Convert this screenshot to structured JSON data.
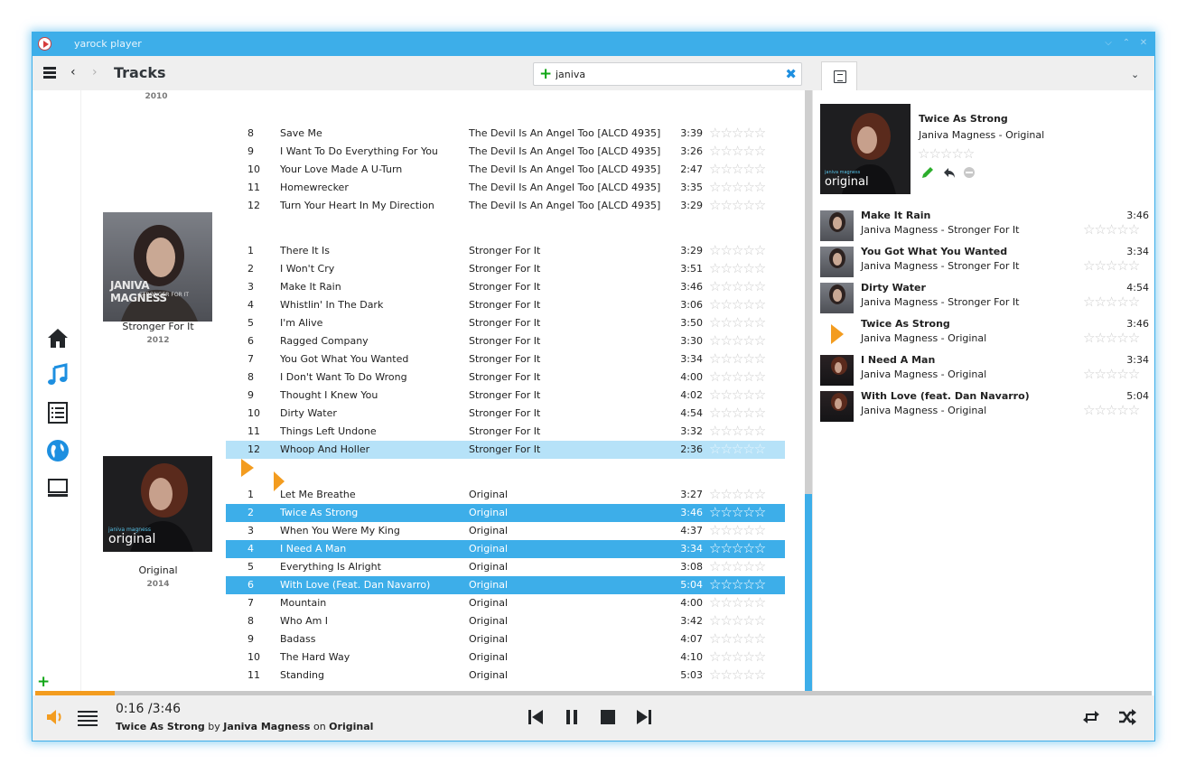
{
  "window": {
    "title": "yarock player"
  },
  "toolbar": {
    "title": "Tracks",
    "back": "‹",
    "forward": "›"
  },
  "search": {
    "value": "janiva",
    "placeholder": ""
  },
  "albums": [
    {
      "year": "2010",
      "name": ""
    },
    {
      "name": "Stronger For It",
      "year": "2012",
      "cover_text": "JANIVA MAGNESS",
      "cover_sub": "STRONGER FOR IT"
    },
    {
      "name": "Original",
      "year": "2014",
      "cover_text": "original",
      "cover_sub": "janiva magness"
    }
  ],
  "tracks_2010": [
    {
      "n": "8",
      "title": "Save Me",
      "album": "The Devil Is An Angel Too [ALCD 4935]",
      "dur": "3:39"
    },
    {
      "n": "9",
      "title": "I Want To Do Everything For You",
      "album": "The Devil Is An Angel Too [ALCD 4935]",
      "dur": "3:26"
    },
    {
      "n": "10",
      "title": "Your Love Made A U-Turn",
      "album": "The Devil Is An Angel Too [ALCD 4935]",
      "dur": "2:47"
    },
    {
      "n": "11",
      "title": "Homewrecker",
      "album": "The Devil Is An Angel Too [ALCD 4935]",
      "dur": "3:35"
    },
    {
      "n": "12",
      "title": "Turn Your Heart In My Direction",
      "album": "The Devil Is An Angel Too [ALCD 4935]",
      "dur": "3:29"
    }
  ],
  "tracks_2012": [
    {
      "n": "1",
      "title": "There It Is",
      "album": "Stronger For It",
      "dur": "3:29"
    },
    {
      "n": "2",
      "title": "I Won't Cry",
      "album": "Stronger For It",
      "dur": "3:51"
    },
    {
      "n": "3",
      "title": "Make It Rain",
      "album": "Stronger For It",
      "dur": "3:46"
    },
    {
      "n": "4",
      "title": "Whistlin' In The Dark",
      "album": "Stronger For It",
      "dur": "3:06"
    },
    {
      "n": "5",
      "title": "I'm Alive",
      "album": "Stronger For It",
      "dur": "3:50"
    },
    {
      "n": "6",
      "title": "Ragged Company",
      "album": "Stronger For It",
      "dur": "3:30"
    },
    {
      "n": "7",
      "title": "You Got What You Wanted",
      "album": "Stronger For It",
      "dur": "3:34"
    },
    {
      "n": "8",
      "title": "I Don't Want To Do Wrong",
      "album": "Stronger For It",
      "dur": "4:00"
    },
    {
      "n": "9",
      "title": "Thought I Knew You",
      "album": "Stronger For It",
      "dur": "4:02"
    },
    {
      "n": "10",
      "title": "Dirty Water",
      "album": "Stronger For It",
      "dur": "4:54"
    },
    {
      "n": "11",
      "title": "Things Left Undone",
      "album": "Stronger For It",
      "dur": "3:32"
    },
    {
      "n": "12",
      "title": "Whoop And Holler",
      "album": "Stronger For It",
      "dur": "2:36"
    }
  ],
  "tracks_2014": [
    {
      "n": "1",
      "title": "Let Me Breathe",
      "album": "Original",
      "dur": "3:27"
    },
    {
      "n": "2",
      "title": "Twice As Strong",
      "album": "Original",
      "dur": "3:46"
    },
    {
      "n": "3",
      "title": "When You Were My King",
      "album": "Original",
      "dur": "4:37"
    },
    {
      "n": "4",
      "title": "I Need A Man",
      "album": "Original",
      "dur": "3:34"
    },
    {
      "n": "5",
      "title": "Everything Is Alright",
      "album": "Original",
      "dur": "3:08"
    },
    {
      "n": "6",
      "title": "With Love (Feat. Dan Navarro)",
      "album": "Original",
      "dur": "5:04"
    },
    {
      "n": "7",
      "title": "Mountain",
      "album": "Original",
      "dur": "4:00"
    },
    {
      "n": "8",
      "title": "Who Am I",
      "album": "Original",
      "dur": "3:42"
    },
    {
      "n": "9",
      "title": "Badass",
      "album": "Original",
      "dur": "4:07"
    },
    {
      "n": "10",
      "title": "The Hard Way",
      "album": "Original",
      "dur": "4:10"
    },
    {
      "n": "11",
      "title": "Standing",
      "album": "Original",
      "dur": "5:03"
    }
  ],
  "rating_stars": "☆☆☆☆☆",
  "now_playing": {
    "title": "Twice As Strong",
    "subtitle": "Janiva Magness - Original",
    "cover_text": "original",
    "cover_sub": "janiva magness"
  },
  "queue": [
    {
      "title": "Make It Rain",
      "sub": "Janiva Magness - Stronger For It",
      "dur": "3:46"
    },
    {
      "title": "You Got What You Wanted",
      "sub": "Janiva Magness - Stronger For It",
      "dur": "3:34"
    },
    {
      "title": "Dirty Water",
      "sub": "Janiva Magness - Stronger For It",
      "dur": "4:54"
    },
    {
      "title": "Twice As Strong",
      "sub": "Janiva Magness - Original",
      "dur": "3:46"
    },
    {
      "title": "I Need A Man",
      "sub": "Janiva Magness - Original",
      "dur": "3:34"
    },
    {
      "title": "With Love (feat. Dan Navarro)",
      "sub": "Janiva Magness - Original",
      "dur": "5:04"
    }
  ],
  "player": {
    "time": "0:16 /3:46",
    "track": "Twice As Strong",
    "by": "by",
    "artist": "Janiva Magness",
    "on": "on",
    "album": "Original",
    "progress": 0.0708
  },
  "colors": {
    "accent": "#3daee9",
    "play": "#f39c1f",
    "add": "#11a616"
  }
}
